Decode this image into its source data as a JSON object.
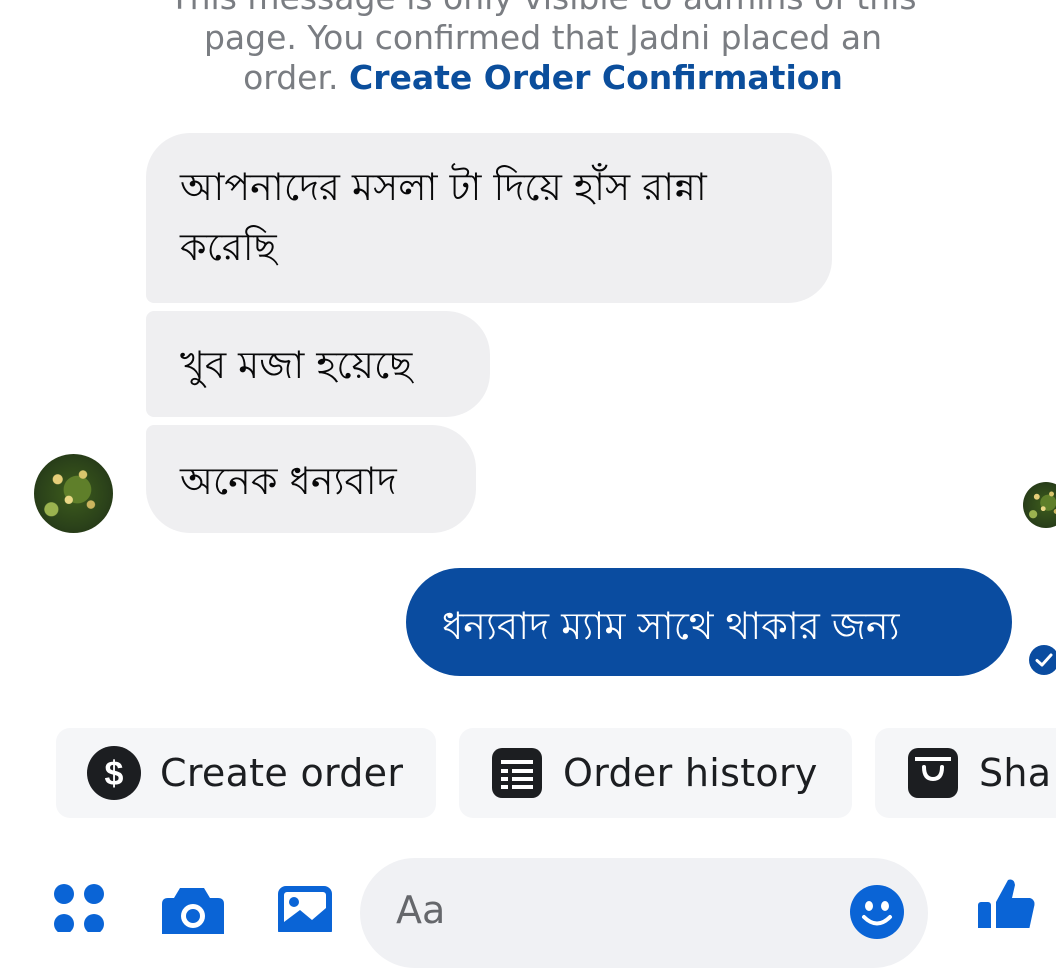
{
  "admin_notice": {
    "line1": "This message is only visible to admins of this",
    "line2": "page. You confirmed that Jadni placed an",
    "line3_prefix": "order. ",
    "link": "Create Order Confirmation"
  },
  "messages": [
    {
      "direction": "incoming",
      "text": "আপনাদের মসলা টা দিয়ে হাঁস রান্না করেছি"
    },
    {
      "direction": "incoming",
      "text": "খুব মজা হয়েছে"
    },
    {
      "direction": "incoming",
      "text": "অনেক ধন্যবাদ"
    },
    {
      "direction": "outgoing",
      "text": "ধন্যবাদ ম্যাম সাথে থাকার জন্য"
    }
  ],
  "contact": {
    "name": "Jadni"
  },
  "quick_actions": [
    {
      "label": "Create order",
      "icon": "dollar-icon"
    },
    {
      "label": "Order history",
      "icon": "receipt-icon"
    },
    {
      "label": "Sha",
      "icon": "shopping-bag-icon"
    }
  ],
  "composer": {
    "placeholder": "Aa",
    "icons": [
      "apps-icon",
      "camera-icon",
      "gallery-icon",
      "emoji-icon",
      "like-icon"
    ]
  },
  "colors": {
    "accent": "#0a4ca0",
    "incoming_bubble": "#efeff1",
    "link": "#0b4e9c"
  }
}
